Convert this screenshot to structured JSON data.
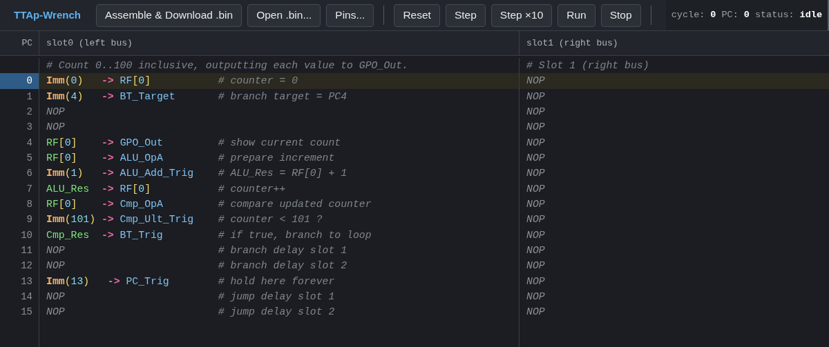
{
  "app": {
    "title": "TTAp-Wrench"
  },
  "toolbar": {
    "groups": [
      {
        "buttons": [
          "Assemble & Download .bin",
          "Open .bin...",
          "Pins..."
        ]
      },
      {
        "buttons": [
          "Reset",
          "Step",
          "Step ×10",
          "Run",
          "Stop"
        ]
      }
    ]
  },
  "status": [
    {
      "label": "cycle:",
      "value": "0"
    },
    {
      "label": "PC:",
      "value": "0"
    },
    {
      "label": "status:",
      "value": "idle"
    }
  ],
  "editor": {
    "pc_header": "PC",
    "columns": [
      "slot0 (left bus)",
      "slot1 (right bus)"
    ],
    "preamble": [
      "# Count 0..100 inclusive, outputting each value to GPO_Out.",
      "# Slot 1 (right bus)"
    ],
    "rows": [
      {
        "pc": "0",
        "selected": true,
        "slots": [
          {
            "move": "Imm(0)   -> RF[0]",
            "comment": "# counter = 0"
          },
          {
            "move": "NOP"
          }
        ]
      },
      {
        "pc": "1",
        "selected": false,
        "slots": [
          {
            "move": "Imm(4)   -> BT_Target",
            "comment": "# branch target = PC4"
          },
          {
            "move": "NOP"
          }
        ]
      },
      {
        "pc": "2",
        "selected": false,
        "slots": [
          {
            "move": "NOP"
          },
          {
            "move": "NOP"
          }
        ]
      },
      {
        "pc": "3",
        "selected": false,
        "slots": [
          {
            "move": "NOP"
          },
          {
            "move": "NOP"
          }
        ]
      },
      {
        "pc": "4",
        "selected": false,
        "slots": [
          {
            "move": "RF[0]    -> GPO_Out",
            "comment": "# show current count"
          },
          {
            "move": "NOP"
          }
        ]
      },
      {
        "pc": "5",
        "selected": false,
        "slots": [
          {
            "move": "RF[0]    -> ALU_OpA",
            "comment": "# prepare increment"
          },
          {
            "move": "NOP"
          }
        ]
      },
      {
        "pc": "6",
        "selected": false,
        "slots": [
          {
            "move": "Imm(1)   -> ALU_Add_Trig",
            "comment": "# ALU_Res = RF[0] + 1"
          },
          {
            "move": "NOP"
          }
        ]
      },
      {
        "pc": "7",
        "selected": false,
        "slots": [
          {
            "move": "ALU_Res  -> RF[0]",
            "comment": "# counter++"
          },
          {
            "move": "NOP"
          }
        ]
      },
      {
        "pc": "8",
        "selected": false,
        "slots": [
          {
            "move": "RF[0]    -> Cmp_OpA",
            "comment": "# compare updated counter"
          },
          {
            "move": "NOP"
          }
        ]
      },
      {
        "pc": "9",
        "selected": false,
        "slots": [
          {
            "move": "Imm(101) -> Cmp_Ult_Trig",
            "comment": "# counter < 101 ?"
          },
          {
            "move": "NOP"
          }
        ]
      },
      {
        "pc": "10",
        "selected": false,
        "slots": [
          {
            "move": "Cmp_Res  -> BT_Trig",
            "comment": "# if true, branch to loop"
          },
          {
            "move": "NOP"
          }
        ]
      },
      {
        "pc": "11",
        "selected": false,
        "slots": [
          {
            "move": "NOP",
            "comment": "# branch delay slot 1"
          },
          {
            "move": "NOP"
          }
        ]
      },
      {
        "pc": "12",
        "selected": false,
        "slots": [
          {
            "move": "NOP",
            "comment": "# branch delay slot 2"
          },
          {
            "move": "NOP"
          }
        ]
      },
      {
        "pc": "13",
        "selected": false,
        "slots": [
          {
            "move": "Imm(13)   -> PC_Trig",
            "comment": "# hold here forever"
          },
          {
            "move": "NOP"
          }
        ]
      },
      {
        "pc": "14",
        "selected": false,
        "slots": [
          {
            "move": "NOP",
            "comment": "# jump delay slot 1"
          },
          {
            "move": "NOP"
          }
        ]
      },
      {
        "pc": "15",
        "selected": false,
        "slots": [
          {
            "move": "NOP",
            "comment": "# jump delay slot 2"
          },
          {
            "move": "NOP"
          }
        ]
      }
    ]
  }
}
